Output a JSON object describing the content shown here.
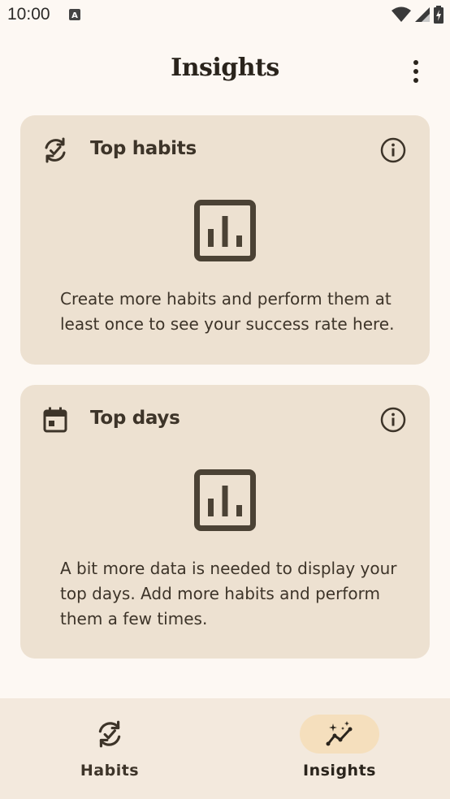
{
  "status_bar": {
    "time": "10:00"
  },
  "app_bar": {
    "title": "Insights"
  },
  "cards": [
    {
      "title": "Top habits",
      "message": "Create more habits and perform them at least once to see your success rate here."
    },
    {
      "title": "Top days",
      "message": "A bit more data is needed to display your top days. Add more habits and perform them a few times."
    }
  ],
  "bottom_nav": {
    "items": [
      {
        "label": "Habits",
        "icon": "habit-check-icon",
        "selected": false
      },
      {
        "label": "Insights",
        "icon": "insights-sparkle-icon",
        "selected": true
      }
    ]
  },
  "colors": {
    "background": "#fdf8f3",
    "card": "#ede1d1",
    "nav_bar": "#f3e9dd",
    "nav_active_pill": "#f5dfbd",
    "text": "#3d3429"
  }
}
